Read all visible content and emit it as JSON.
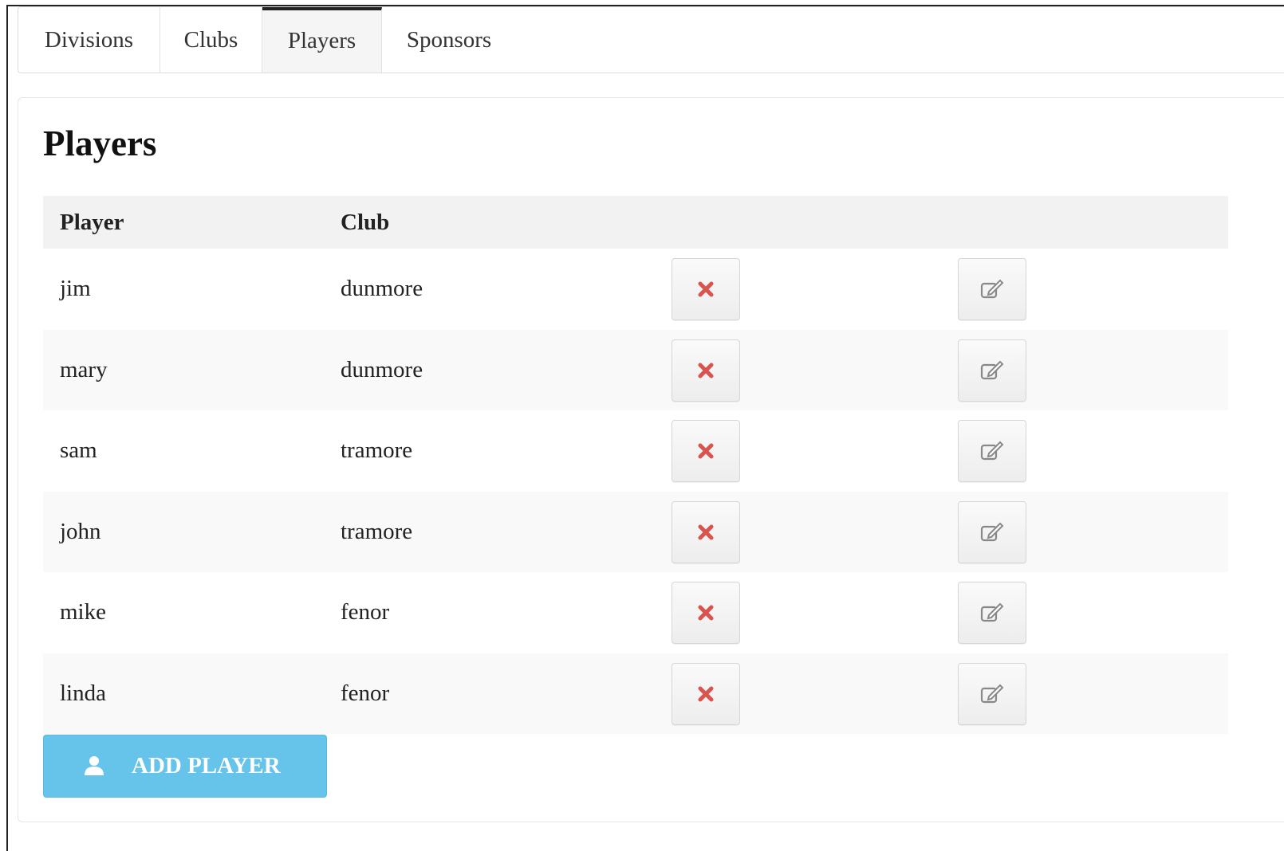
{
  "tabs": [
    {
      "label": "Divisions"
    },
    {
      "label": "Clubs"
    },
    {
      "label": "Players",
      "active": true
    },
    {
      "label": "Sponsors"
    }
  ],
  "page": {
    "title": "Players"
  },
  "table": {
    "headers": {
      "player": "Player",
      "club": "Club"
    },
    "rows": [
      {
        "player": "jim",
        "club": "dunmore"
      },
      {
        "player": "mary",
        "club": "dunmore"
      },
      {
        "player": "sam",
        "club": "tramore"
      },
      {
        "player": "john",
        "club": "tramore"
      },
      {
        "player": "mike",
        "club": "fenor"
      },
      {
        "player": "linda",
        "club": "fenor"
      }
    ],
    "row_actions": {
      "delete_icon": "close-icon",
      "edit_icon": "edit-icon"
    }
  },
  "add_button": {
    "label": "ADD PLAYER",
    "icon": "user-icon"
  },
  "colors": {
    "accent": "#66c3ea",
    "delete": "#d9534f"
  }
}
